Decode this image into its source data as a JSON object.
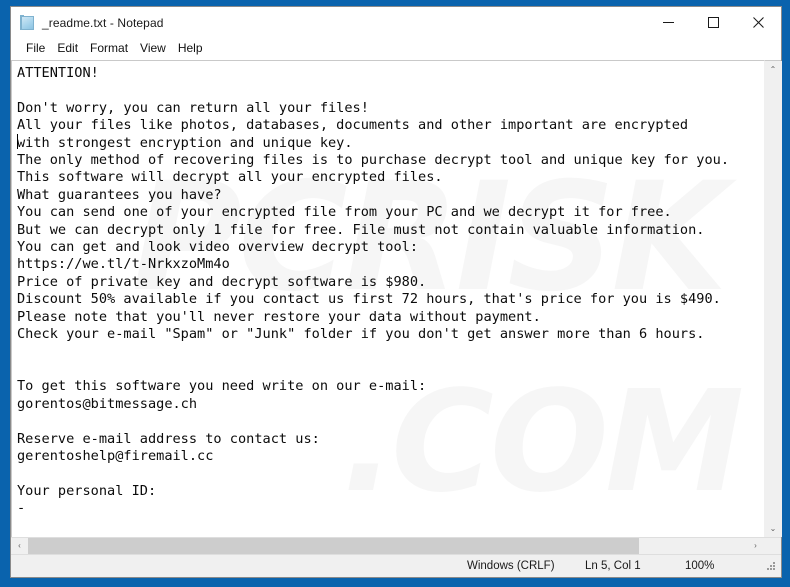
{
  "window": {
    "title": "_readme.txt - Notepad",
    "app_icon": "notepad-document-icon",
    "controls": {
      "minimize_label": "Minimize",
      "maximize_label": "Maximize",
      "close_label": "Close"
    }
  },
  "menu": {
    "items": [
      {
        "label": "File"
      },
      {
        "label": "Edit"
      },
      {
        "label": "Format"
      },
      {
        "label": "View"
      },
      {
        "label": "Help"
      }
    ]
  },
  "document": {
    "filename": "_readme.txt",
    "body": "ATTENTION!\n\nDon't worry, you can return all your files!\nAll your files like photos, databases, documents and other important are encrypted\nwith strongest encryption and unique key.\nThe only method of recovering files is to purchase decrypt tool and unique key for you.\nThis software will decrypt all your encrypted files.\nWhat guarantees you have?\nYou can send one of your encrypted file from your PC and we decrypt it for free.\nBut we can decrypt only 1 file for free. File must not contain valuable information.\nYou can get and look video overview decrypt tool:\nhttps://we.tl/t-NrkxzoMm4o\nPrice of private key and decrypt software is $980.\nDiscount 50% available if you contact us first 72 hours, that's price for you is $490.\nPlease note that you'll never restore your data without payment.\nCheck your e-mail \"Spam\" or \"Junk\" folder if you don't get answer more than 6 hours.\n\n\nTo get this software you need write on our e-mail:\ngorentos@bitmessage.ch\n\nReserve e-mail address to contact us:\ngerentoshelp@firemail.cc\n\nYour personal ID:\n-",
    "lines": [
      "ATTENTION!",
      "",
      "Don't worry, you can return all your files!",
      "All your files like photos, databases, documents and other important are encrypted",
      "with strongest encryption and unique key.",
      "The only method of recovering files is to purchase decrypt tool and unique key for you.",
      "This software will decrypt all your encrypted files.",
      "What guarantees you have?",
      "You can send one of your encrypted file from your PC and we decrypt it for free.",
      "But we can decrypt only 1 file for free. File must not contain valuable information.",
      "You can get and look video overview decrypt tool:",
      "https://we.tl/t-NrkxzoMm4o",
      "Price of private key and decrypt software is $980.",
      "Discount 50% available if you contact us first 72 hours, that's price for you is $490.",
      "Please note that you'll never restore your data without payment.",
      "Check your e-mail \"Spam\" or \"Junk\" folder if you don't get answer more than 6 hours.",
      "",
      "",
      "To get this software you need write on our e-mail:",
      "gorentos@bitmessage.ch",
      "",
      "Reserve e-mail address to contact us:",
      "gerentoshelp@firemail.cc",
      "",
      "Your personal ID:",
      "-"
    ],
    "ransom_details": {
      "download_url": "https://we.tl/t-NrkxzoMm4o",
      "full_price": "$980",
      "discount_price": "$490",
      "discount_percent": "50%",
      "discount_window": "72 hours",
      "response_time": "6 hours",
      "primary_email": "gorentos@bitmessage.ch",
      "reserve_email": "gerentoshelp@firemail.cc",
      "personal_id": "-",
      "free_files": "1 file"
    }
  },
  "status_bar": {
    "encoding": "Windows (CRLF)",
    "position": "Ln 5, Col 1",
    "zoom": "100%"
  },
  "scrollbars": {
    "vertical_up_glyph": "⌃",
    "vertical_down_glyph": "⌄",
    "horizontal_left_glyph": "‹",
    "horizontal_right_glyph": "›",
    "horizontal_thumb_percent": "85"
  },
  "watermark": {
    "text_a": "PCRISK",
    "text_b": ".COM"
  },
  "colors": {
    "desktop_blue": "#0a63ad",
    "window_background": "#ffffff",
    "text_color": "#0b0b0b",
    "chrome_gray": "#f0f0f0",
    "scroll_thumb": "#cdcdcd",
    "close_hover": "#e81123"
  }
}
